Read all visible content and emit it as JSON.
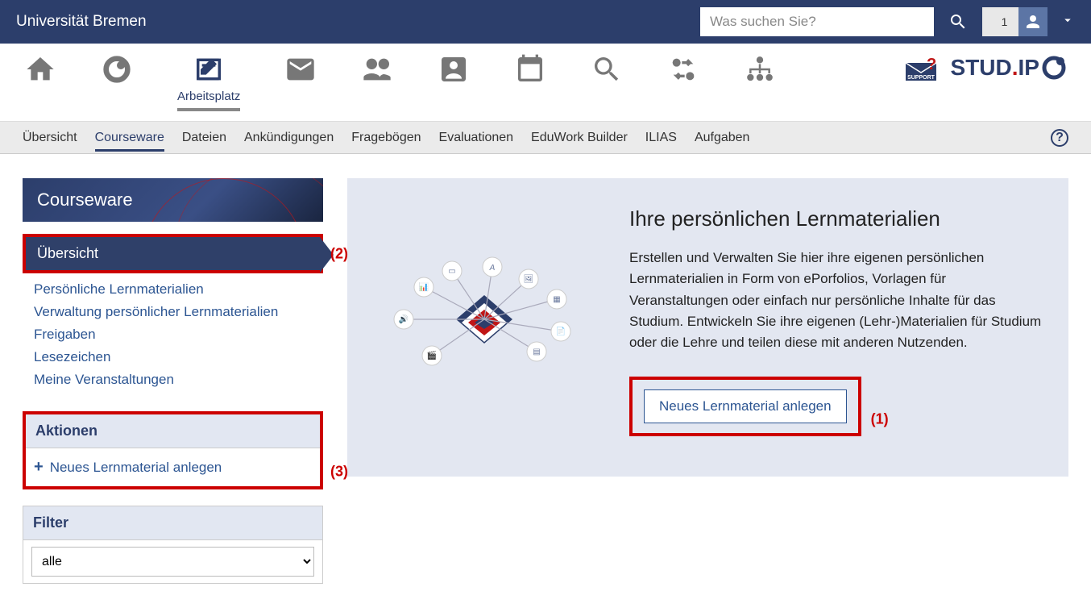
{
  "header": {
    "site_title": "Universität Bremen",
    "search_placeholder": "Was suchen Sie?",
    "user_count": "1"
  },
  "main_nav": {
    "arbeitsplatz_label": "Arbeitsplatz"
  },
  "logo": {
    "stud": "STUD",
    "dot": ".",
    "ip": "IP"
  },
  "sub_tabs": [
    "Übersicht",
    "Courseware",
    "Dateien",
    "Ankündigungen",
    "Fragebögen",
    "Evaluationen",
    "EduWork Builder",
    "ILIAS",
    "Aufgaben"
  ],
  "sidebar": {
    "title": "Courseware",
    "active_item": "Übersicht",
    "items": [
      "Persönliche Lernmaterialien",
      "Verwaltung persönlicher Lernmaterialien",
      "Freigaben",
      "Lesezeichen",
      "Meine Veranstaltungen"
    ],
    "actions_header": "Aktionen",
    "action_new": "Neues Lernmaterial anlegen",
    "filter_header": "Filter",
    "filter_value": "alle"
  },
  "main": {
    "title": "Ihre persönlichen Lernmaterialien",
    "description": "Erstellen und Verwalten Sie hier ihre eigenen persönlichen Lernmaterialien in Form von ePorfolios, Vorlagen für Veranstaltungen oder einfach nur persönliche Inhalte für das Studium. Entwickeln Sie ihre eigenen (Lehr-)Materialien für Studium oder die Lehre und teilen diese mit anderen Nutzenden.",
    "create_button": "Neues Lernmaterial anlegen"
  },
  "highlights": {
    "one": "(1)",
    "two": "(2)",
    "three": "(3)"
  }
}
